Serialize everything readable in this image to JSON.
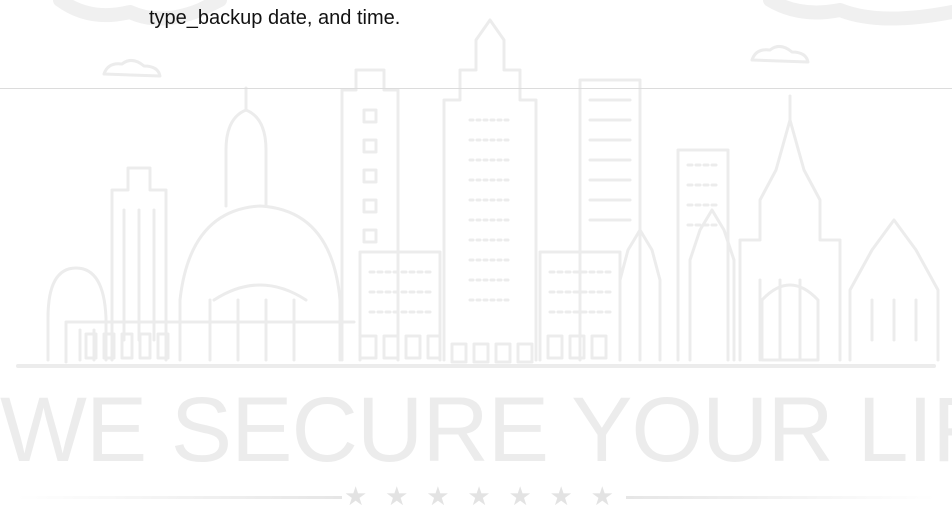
{
  "content": {
    "text": "type_backup date, and time."
  },
  "banner": {
    "tagline": "WE SECURE YOUR LIFE",
    "stars": [
      "★",
      "★",
      "★",
      "★",
      "★",
      "★",
      "★"
    ],
    "illustration": "city-skyline-icon"
  },
  "colors": {
    "text": "#111111",
    "divider": "#dcdcdc",
    "watermark": "#ececec"
  }
}
